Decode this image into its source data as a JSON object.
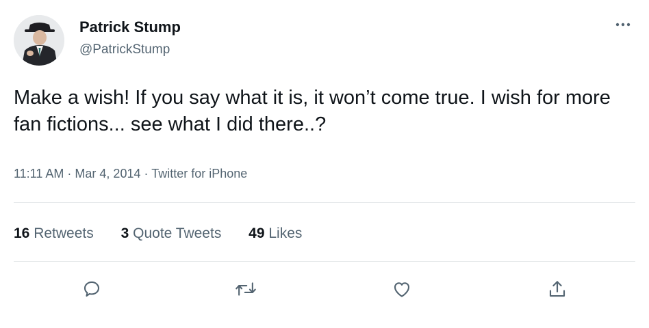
{
  "author": {
    "name": "Patrick Stump",
    "handle": "@PatrickStump"
  },
  "tweet": {
    "text": "Make a wish! If you say what it is, it won’t come true. I wish for more fan fictions... see what I did there..?",
    "time": "11:11 AM",
    "separator": "·",
    "date": "Mar 4, 2014",
    "source": "Twitter for iPhone"
  },
  "stats": {
    "retweets_count": "16",
    "retweets_label": "Retweets",
    "quotes_count": "3",
    "quotes_label": "Quote Tweets",
    "likes_count": "49",
    "likes_label": "Likes"
  },
  "icons": {
    "more": "more-horizontal-icon",
    "reply": "reply-icon",
    "retweet": "retweet-icon",
    "like": "heart-icon",
    "share": "share-icon"
  },
  "colors": {
    "text_primary": "#0f1419",
    "text_secondary": "#536471",
    "divider": "#e3e6e8"
  }
}
